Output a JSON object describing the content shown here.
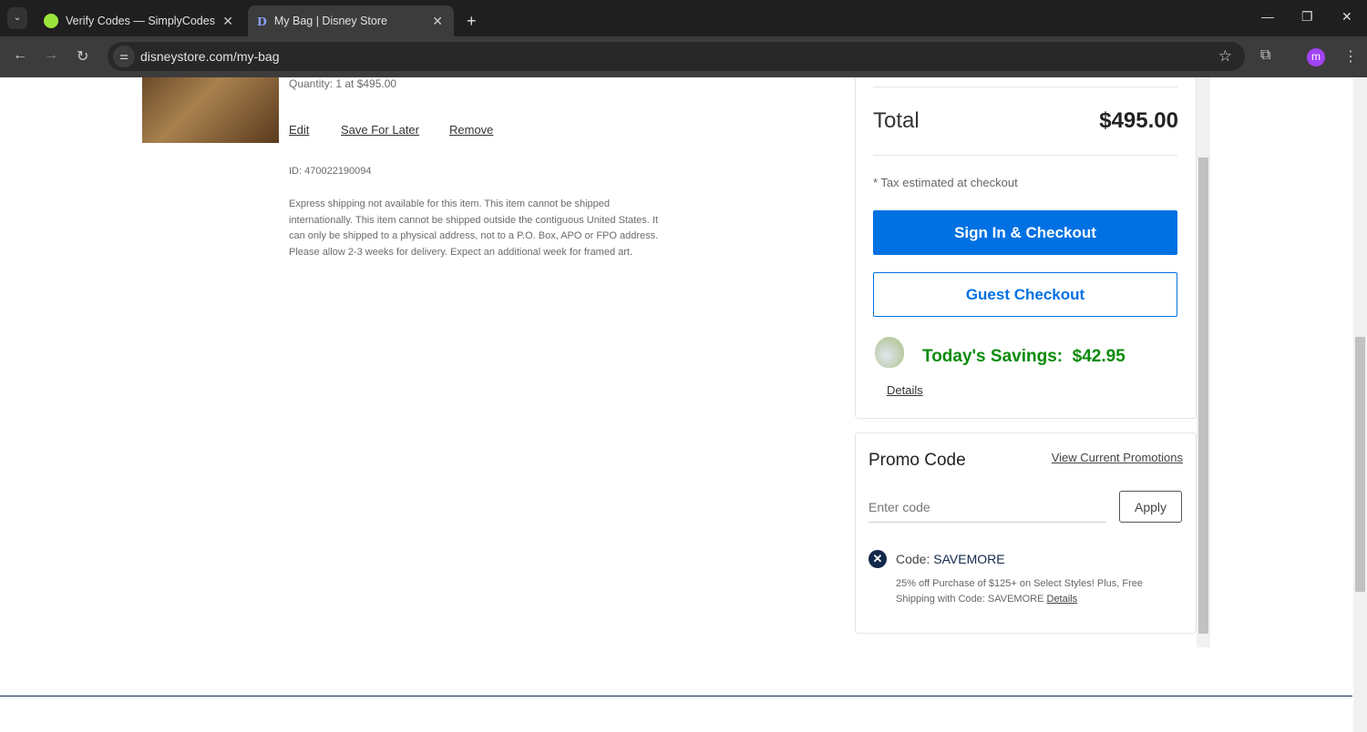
{
  "browser": {
    "tabs": [
      {
        "title": "Verify Codes — SimplyCodes"
      },
      {
        "title": "My Bag | Disney Store"
      }
    ],
    "url": "disneystore.com/my-bag",
    "profile_initial": "m"
  },
  "item": {
    "quantity": "Quantity: 1 at $495.00",
    "edit": "Edit",
    "save_for_later": "Save For Later",
    "remove": "Remove",
    "id": "ID: 470022190094",
    "shipping_note": "Express shipping not available for this item. This item cannot be shipped internationally. This item cannot be shipped outside the contiguous United States. It can only be shipped to a physical address, not to a P.O. Box, APO or FPO address. Please allow 2-3 weeks for delivery. Expect an additional week for framed art."
  },
  "summary": {
    "total_label": "Total",
    "total_value": "$495.00",
    "tax_note": "* Tax estimated at checkout",
    "signin_checkout": "Sign In & Checkout",
    "guest_checkout": "Guest Checkout",
    "savings_label": "Today's Savings:",
    "savings_value": "$42.95",
    "details": "Details"
  },
  "promo": {
    "title": "Promo Code",
    "view_promotions": "View Current Promotions",
    "placeholder": "Enter code",
    "apply": "Apply",
    "code_label": "Code:",
    "code": "SAVEMORE",
    "description": "25% off Purchase of $125+ on Select Styles! Plus, Free Shipping with Code: SAVEMORE",
    "details": "Details"
  },
  "colors": {
    "primary": "#0071e3",
    "savings": "#0a8a0a",
    "navy": "#13294b"
  }
}
